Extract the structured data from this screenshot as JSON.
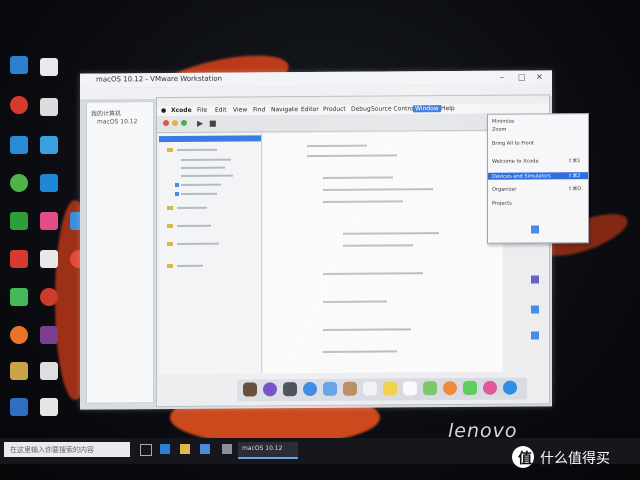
{
  "vmware": {
    "window_title": "macOS 10.12 - VMware Workstation",
    "library_items": [
      "我的计算机",
      "macOS 10.12"
    ]
  },
  "macos": {
    "menubar": [
      "Xcode",
      "File",
      "Edit",
      "View",
      "Find",
      "Navigate",
      "Editor",
      "Product",
      "Debug",
      "Source Control",
      "Window",
      "Help"
    ],
    "active_menu": "Window",
    "dropdown_items": [
      "Minimize",
      "Zoom",
      "",
      "Bring All to Front",
      "Welcome to Xcode",
      "Devices and Simulators",
      "Organizer",
      "",
      "Projects"
    ],
    "dropdown_shortcuts": [
      "",
      "",
      "",
      "",
      "⇧⌘1",
      "⇧⌘2",
      "⇧⌘O",
      "",
      ""
    ],
    "selected_dropdown_index": 5
  },
  "taskbar": {
    "search_placeholder": "在这里输入你要搜索的内容",
    "active_app": "macOS 10.12"
  },
  "brand": {
    "monitor_logo": "lenovo"
  },
  "watermark": {
    "badge": "值",
    "text": "什么值得买"
  },
  "colors": {
    "selection": "#2e6fdc",
    "wallpaper_red": "#d8431c",
    "taskbar": "#15171c"
  }
}
